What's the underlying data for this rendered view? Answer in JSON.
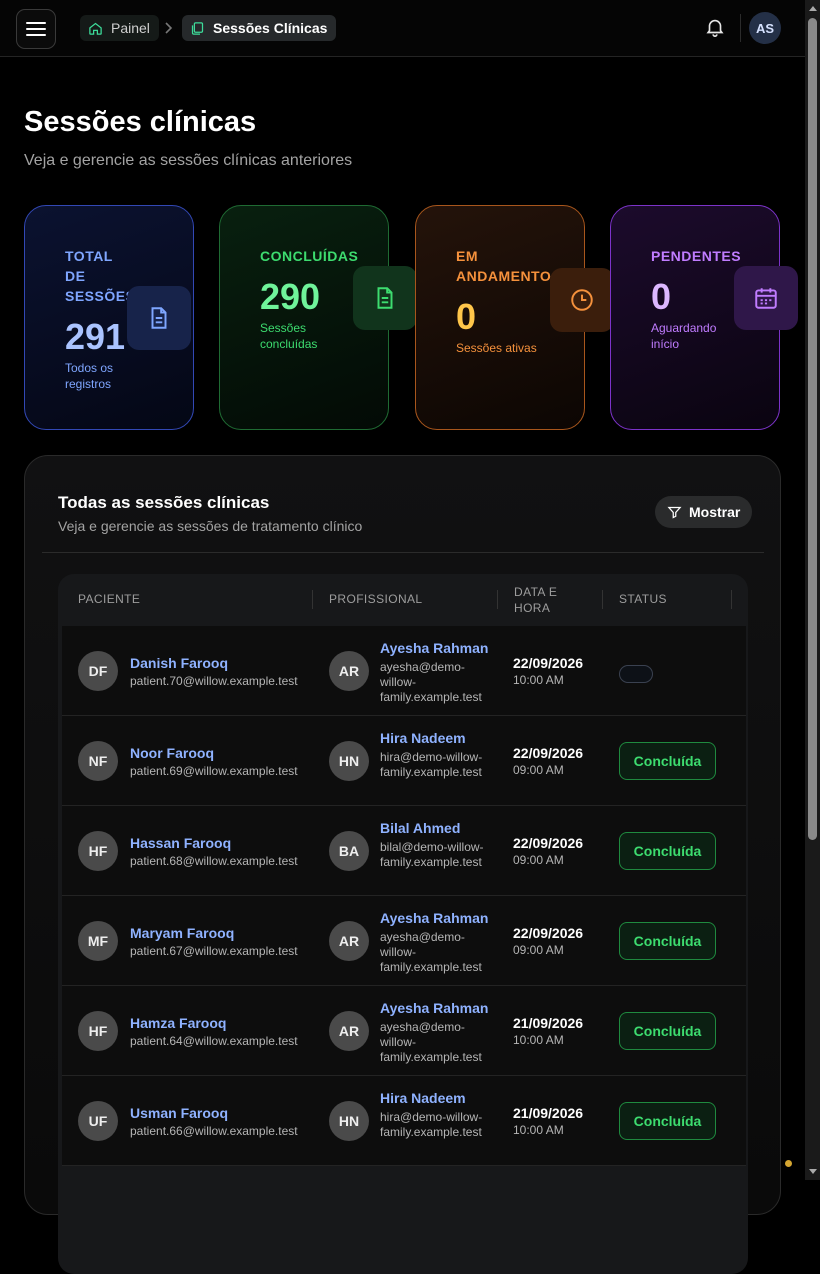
{
  "topbar": {
    "breadcrumb": [
      {
        "label": "Painel",
        "icon": "home-icon"
      },
      {
        "label": "Sessões Clínicas",
        "icon": "documents-icon"
      }
    ],
    "user_initials": "AS"
  },
  "header": {
    "title": "Sessões clínicas",
    "subtitle": "Veja e gerencie as sessões clínicas anteriores"
  },
  "stats": [
    {
      "label": "TOTAL DE SESSÕES",
      "value": "291",
      "description": "Todos os registros",
      "icon": "document-icon",
      "color": "#7fa6ff"
    },
    {
      "label": "CONCLUÍDAS",
      "value": "290",
      "description": "Sessões concluídas",
      "icon": "document-icon",
      "color": "#3ddc6f"
    },
    {
      "label": "EM ANDAMENTO",
      "value": "0",
      "description": "Sessões ativas",
      "icon": "clock-icon",
      "color": "#f5913c"
    },
    {
      "label": "PENDENTES",
      "value": "0",
      "description": "Aguardando início",
      "icon": "calendar-icon",
      "color": "#c07cff"
    }
  ],
  "sessions": {
    "title": "Todas as sessões clínicas",
    "subtitle": "Veja e gerencie as sessões de tratamento clínico",
    "filter_label": "Mostrar",
    "columns": [
      "PACIENTE",
      "PROFISSIONAL",
      "DATA E HORA",
      "STATUS"
    ],
    "rows": [
      {
        "patient_initials": "DF",
        "patient_name": "Danish Farooq",
        "patient_email": "patient.70@willow.example.test",
        "pro_initials": "AR",
        "pro_name": "Ayesha Rahman",
        "pro_email": "ayesha@demo-willow-family.example.test",
        "date": "22/09/2026",
        "time": "10:00 AM",
        "status": ""
      },
      {
        "patient_initials": "NF",
        "patient_name": "Noor Farooq",
        "patient_email": "patient.69@willow.example.test",
        "pro_initials": "HN",
        "pro_name": "Hira Nadeem",
        "pro_email": "hira@demo-willow-family.example.test",
        "date": "22/09/2026",
        "time": "09:00 AM",
        "status": "Concluída"
      },
      {
        "patient_initials": "HF",
        "patient_name": "Hassan Farooq",
        "patient_email": "patient.68@willow.example.test",
        "pro_initials": "BA",
        "pro_name": "Bilal Ahmed",
        "pro_email": "bilal@demo-willow-family.example.test",
        "date": "22/09/2026",
        "time": "09:00 AM",
        "status": "Concluída"
      },
      {
        "patient_initials": "MF",
        "patient_name": "Maryam Farooq",
        "patient_email": "patient.67@willow.example.test",
        "pro_initials": "AR",
        "pro_name": "Ayesha Rahman",
        "pro_email": "ayesha@demo-willow-family.example.test",
        "date": "22/09/2026",
        "time": "09:00 AM",
        "status": "Concluída"
      },
      {
        "patient_initials": "HF",
        "patient_name": "Hamza Farooq",
        "patient_email": "patient.64@willow.example.test",
        "pro_initials": "AR",
        "pro_name": "Ayesha Rahman",
        "pro_email": "ayesha@demo-willow-family.example.test",
        "date": "21/09/2026",
        "time": "10:00 AM",
        "status": "Concluída"
      },
      {
        "patient_initials": "UF",
        "patient_name": "Usman Farooq",
        "patient_email": "patient.66@willow.example.test",
        "pro_initials": "HN",
        "pro_name": "Hira Nadeem",
        "pro_email": "hira@demo-willow-family.example.test",
        "date": "21/09/2026",
        "time": "10:00 AM",
        "status": "Concluída"
      }
    ]
  }
}
